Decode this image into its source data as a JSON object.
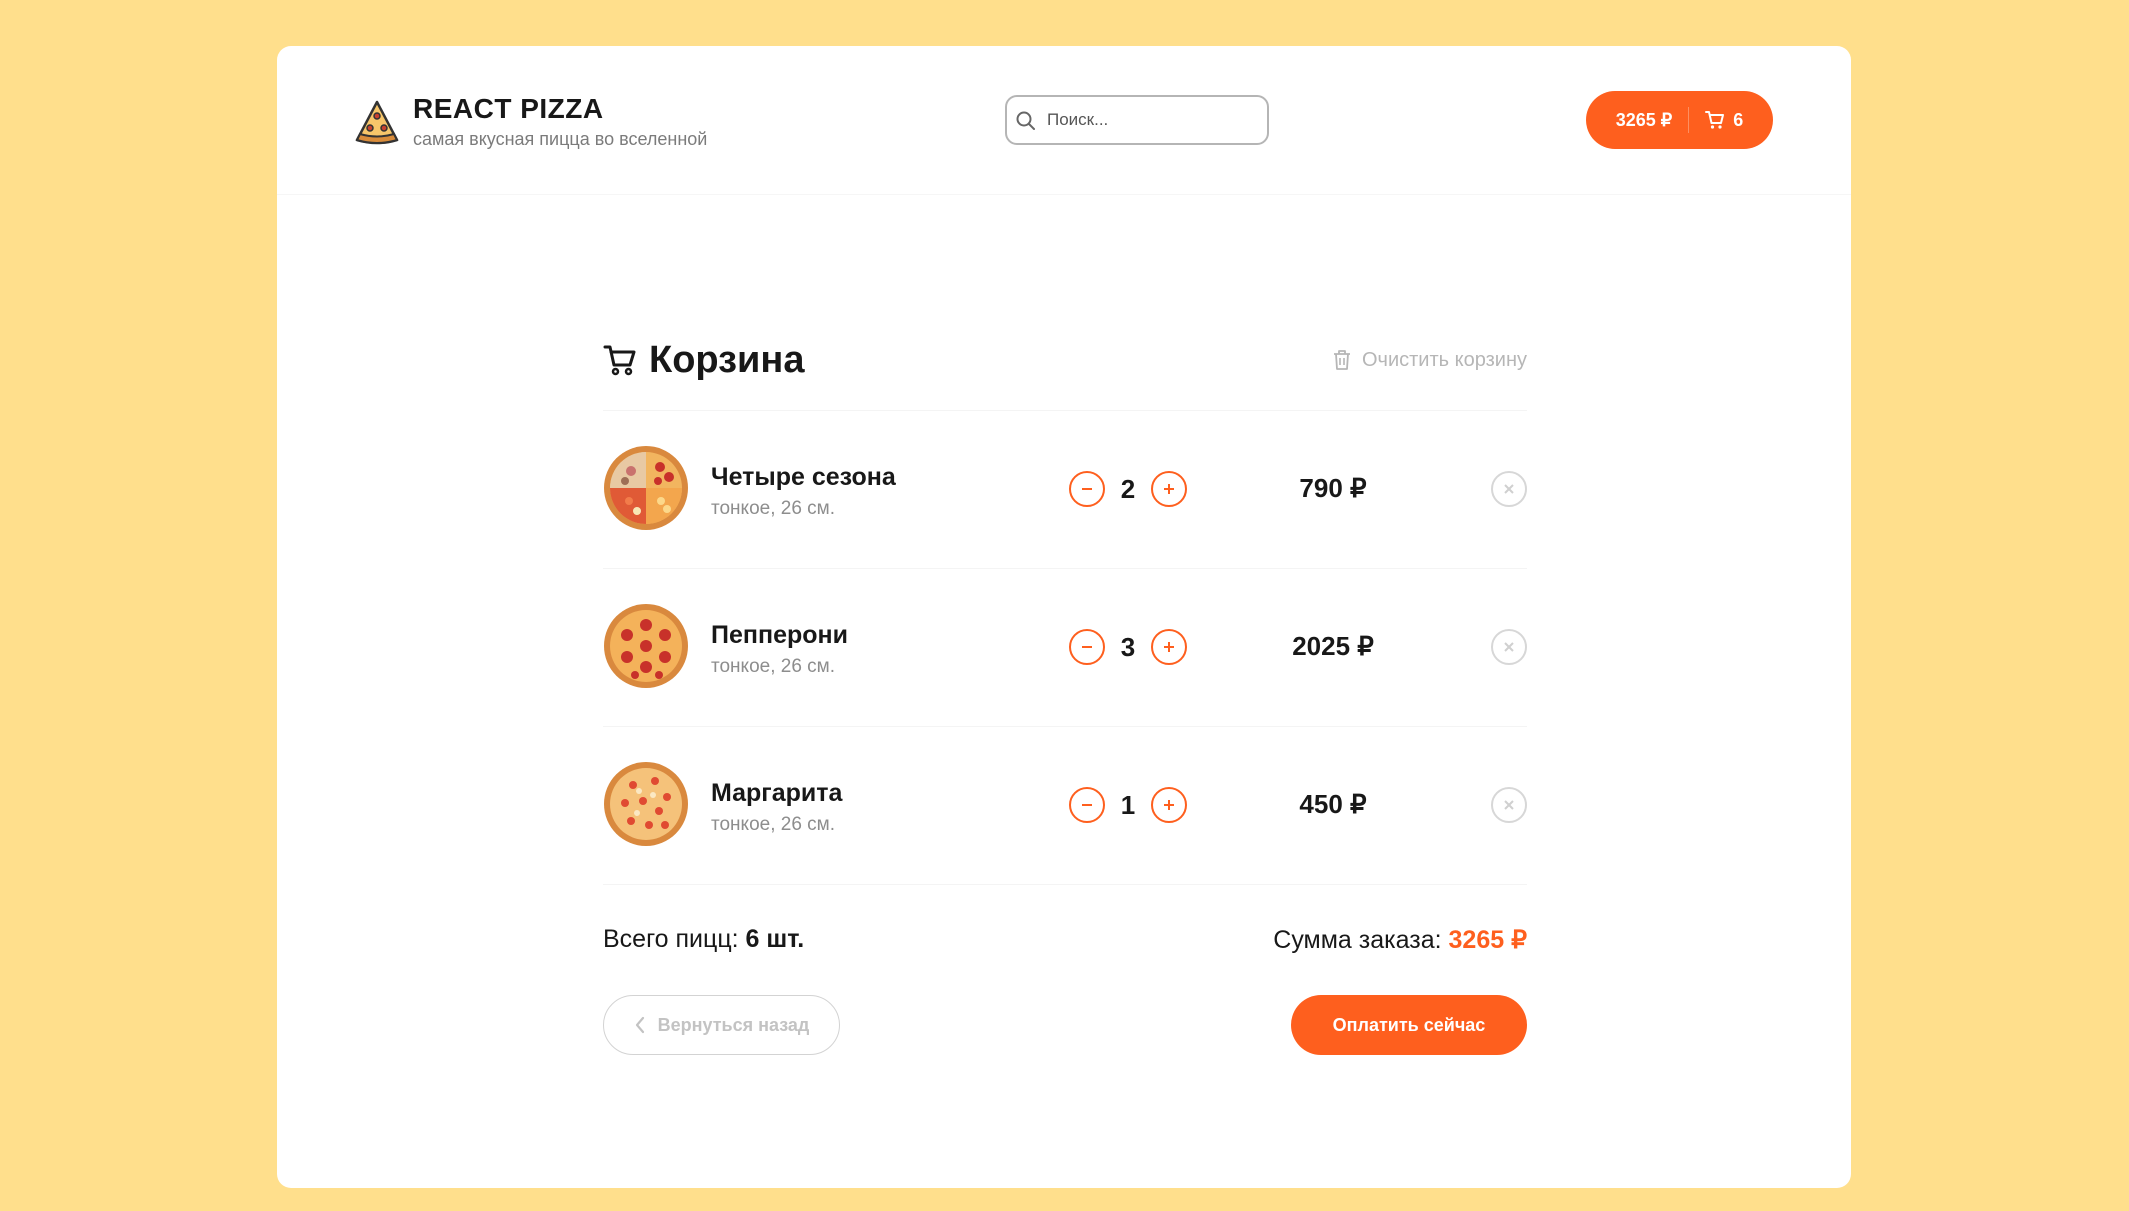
{
  "header": {
    "logo_title": "REACT PIZZA",
    "logo_subtitle": "самая вкусная пицца во вселенной",
    "search_placeholder": "Поиск...",
    "cart_price": "3265 ₽",
    "cart_count": "6"
  },
  "cart": {
    "title": "Корзина",
    "clear_label": "Очистить корзину",
    "items": [
      {
        "name": "Четыре сезона",
        "desc": "тонкое, 26 см.",
        "count": "2",
        "price": "790 ₽"
      },
      {
        "name": "Пепперони",
        "desc": "тонкое, 26 см.",
        "count": "3",
        "price": "2025 ₽"
      },
      {
        "name": "Маргарита",
        "desc": "тонкое, 26 см.",
        "count": "1",
        "price": "450 ₽"
      }
    ],
    "total_count_label": "Всего пицц:",
    "total_count_value": "6 шт.",
    "total_sum_label": "Сумма заказа:",
    "total_sum_value": "3265 ₽",
    "back_label": "Вернуться назад",
    "pay_label": "Оплатить сейчас"
  },
  "colors": {
    "accent": "#FE5F1E",
    "background": "#FFDF8C"
  },
  "icons": [
    "pizza-logo-icon",
    "search-icon",
    "cart-icon",
    "trash-icon",
    "minus-icon",
    "plus-icon",
    "close-icon",
    "chevron-left-icon"
  ]
}
